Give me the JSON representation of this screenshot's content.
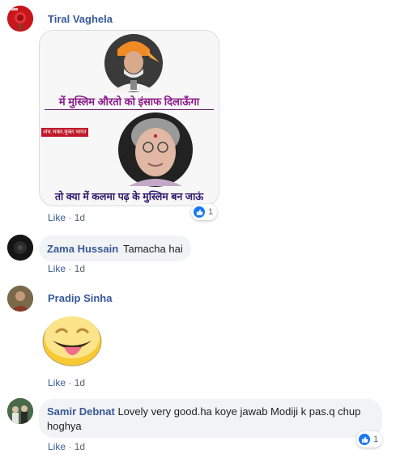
{
  "comments": [
    {
      "author": "Tiral Vaghela",
      "meme_lines": [
        "में मुस्लिम औरतो को इंसाफ दिलाऊँगा",
        "तो क्या में कलमा पढ़ के मुस्लिम बन जाऊं"
      ],
      "meme_tag": "अंध.भक्त.मुक्त.भारत",
      "like_label": "Like",
      "sep": "·",
      "time": "1d",
      "reaction_count": "1"
    },
    {
      "author": "Zama Hussain",
      "text": "Tamacha hai",
      "like_label": "Like",
      "sep": "·",
      "time": "1d"
    },
    {
      "author": "Pradip Sinha",
      "sticker": "tongue-out-emoji",
      "like_label": "Like",
      "sep": "·",
      "time": "1d"
    },
    {
      "author": "Samir Debnat",
      "text_line1": "Lovely very good.ha koye jawab Modiji k pas.q chup",
      "text_line2": "hoghya",
      "like_label": "Like",
      "sep": "·",
      "time": "1d",
      "reaction_count": "1"
    }
  ],
  "icons": {
    "reaction": "thumbs-up-icon"
  },
  "colors": {
    "name": "#385898",
    "bubble": "#f2f3f5",
    "reaction_blue": "#1877f2",
    "meme_text": "#8b1a8b"
  }
}
